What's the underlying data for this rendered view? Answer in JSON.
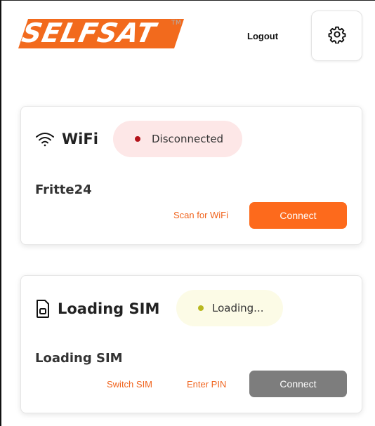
{
  "header": {
    "logo_text": "SELFSAT",
    "logo_trademark": "TM",
    "logout_label": "Logout",
    "settings_icon": "gear-icon"
  },
  "colors": {
    "accent": "#fd6a1c",
    "disconnected_dot": "#b3121a",
    "disconnected_bg": "#fde7e7",
    "loading_dot": "#b8b820",
    "loading_bg": "#fcfbe6",
    "disabled_button": "#7d7d7d"
  },
  "wifi_card": {
    "icon": "wifi-icon",
    "title": "WiFi",
    "status": "Disconnected",
    "network_name": "Fritte24",
    "scan_label": "Scan for WiFi",
    "connect_label": "Connect"
  },
  "sim_card": {
    "icon": "sim-card-icon",
    "title": "Loading SIM",
    "status": "Loading...",
    "sim_name": "Loading SIM",
    "switch_label": "Switch SIM",
    "pin_label": "Enter PIN",
    "connect_label": "Connect"
  }
}
